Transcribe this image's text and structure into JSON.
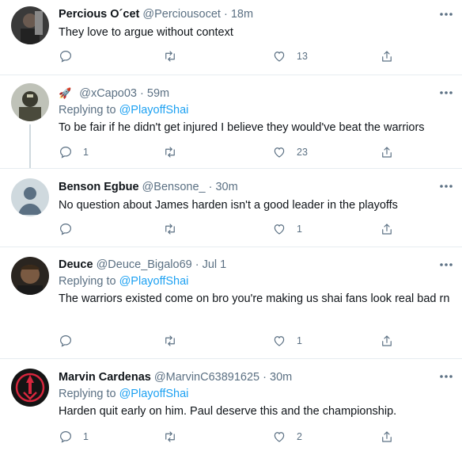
{
  "tweets": [
    {
      "name": "Percious O´cet",
      "handle": "@Perciousocet",
      "time": "18m",
      "reply_to": "",
      "text": "They love to argue without context",
      "counts": {
        "reply": "",
        "retweet": "",
        "like": "13"
      }
    },
    {
      "name": "",
      "handle": "@xCapo03",
      "time": "59m",
      "reply_to": "@PlayoffShai",
      "text": "To be fair if he didn't get injured I believe they would've beat the warriors",
      "counts": {
        "reply": "1",
        "retweet": "",
        "like": "23"
      }
    },
    {
      "name": "Benson Egbue",
      "handle": "@Bensone_",
      "time": "30m",
      "reply_to": "",
      "text": "No question about James harden isn't a good leader in the playoffs",
      "counts": {
        "reply": "",
        "retweet": "",
        "like": "1"
      }
    },
    {
      "name": "Deuce",
      "handle": "@Deuce_Bigalo69",
      "time": "Jul 1",
      "reply_to": "@PlayoffShai",
      "text": "The warriors existed come on bro you're making us shai fans look real bad rn",
      "counts": {
        "reply": "",
        "retweet": "",
        "like": "1"
      }
    },
    {
      "name": "Marvin Cardenas",
      "handle": "@MarvinC63891625",
      "time": "30m",
      "reply_to": "@PlayoffShai",
      "text": "Harden quit early on him. Paul deserve this and the championship.",
      "counts": {
        "reply": "1",
        "retweet": "",
        "like": "2"
      }
    }
  ],
  "labels": {
    "replying_to": "Replying to",
    "dot": "·",
    "rocket": "🚀"
  },
  "colors": {
    "link": "#1da1f2",
    "muted": "#5b7083",
    "text": "#0f1419",
    "divider": "#e6ecf0"
  }
}
